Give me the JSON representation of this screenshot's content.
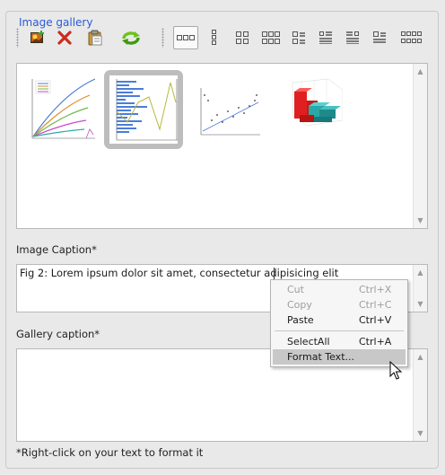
{
  "gallery": {
    "title": "Image gallery",
    "toolbar": [
      {
        "name": "insert-image-icon"
      },
      {
        "name": "delete-icon"
      },
      {
        "name": "paste-icon"
      },
      {
        "name": "refresh-icon"
      },
      {
        "name": "layout-1x3-icon",
        "active": true
      },
      {
        "name": "layout-3x1-icon"
      },
      {
        "name": "layout-2x2-icon"
      },
      {
        "name": "layout-2x3-icon"
      },
      {
        "name": "layout-left-list-icon"
      },
      {
        "name": "layout-list-icon"
      },
      {
        "name": "layout-right-list-icon"
      },
      {
        "name": "layout-image-list-icon"
      },
      {
        "name": "layout-4x2-icon"
      }
    ],
    "thumbnails": [
      {
        "name": "thumbnail-line-chart",
        "selected": false
      },
      {
        "name": "thumbnail-bar-chart",
        "selected": true
      },
      {
        "name": "thumbnail-scatter-plot",
        "selected": false
      },
      {
        "name": "thumbnail-3d-bar-chart",
        "selected": false
      }
    ]
  },
  "image_caption": {
    "label": "Image Caption*",
    "value": "Fig 2: Lorem ipsum dolor sit amet, consectetur adipisicing elit"
  },
  "gallery_caption": {
    "label": "Gallery caption*",
    "value": ""
  },
  "footnote": "*Right-click on your text to format it",
  "context_menu": {
    "items": [
      {
        "label": "Cut",
        "shortcut": "Ctrl+X",
        "enabled": false
      },
      {
        "label": "Copy",
        "shortcut": "Ctrl+C",
        "enabled": false
      },
      {
        "label": "Paste",
        "shortcut": "Ctrl+V",
        "enabled": true
      },
      {
        "label": "SelectAll",
        "shortcut": "Ctrl+A",
        "enabled": true
      },
      {
        "label": "Format Text...",
        "shortcut": "",
        "enabled": true,
        "highlighted": true
      }
    ]
  },
  "colors": {
    "accent": "#2a5bd6",
    "selected_thumb": "#bdbdbd",
    "menu_highlight": "#c8c8c8"
  }
}
